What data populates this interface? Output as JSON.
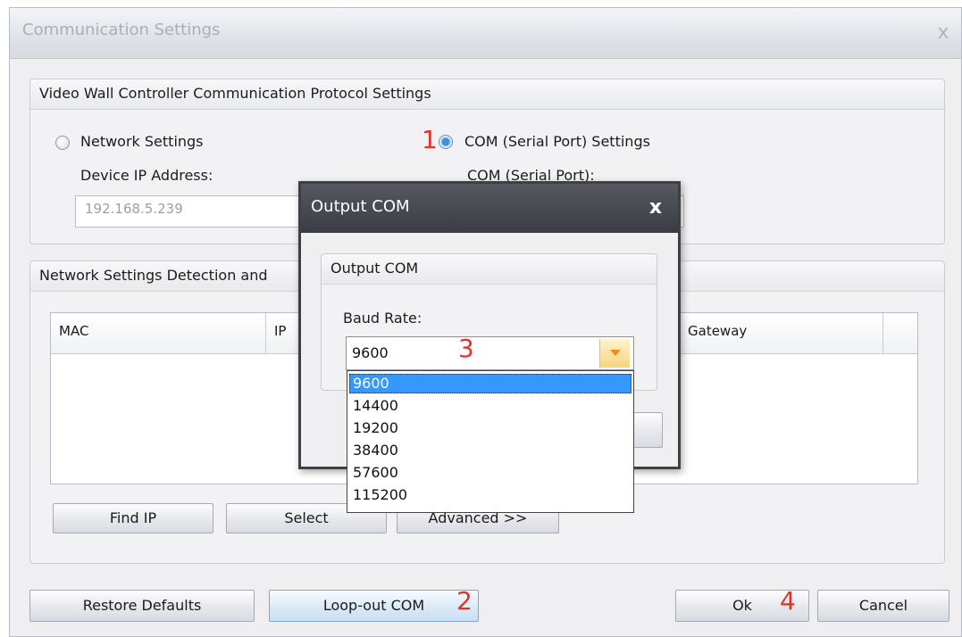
{
  "window": {
    "title": "Communication Settings",
    "close_glyph": "x"
  },
  "protocol_group": {
    "title": "Video Wall Controller Communication Protocol Settings",
    "network_radio_label": "Network Settings",
    "device_ip_label": "Device IP Address:",
    "device_ip_value": "192.168.5.239",
    "com_radio_label": "COM (Serial Port) Settings",
    "com_port_label": "COM (Serial Port):"
  },
  "detection_group": {
    "title": "Network Settings Detection and",
    "columns": [
      "MAC",
      "IP",
      "Gateway"
    ],
    "buttons": {
      "find_ip": "Find IP",
      "select": "Select",
      "advanced": "Advanced >>"
    }
  },
  "footer": {
    "restore_defaults": "Restore Defaults",
    "loop_out_com": "Loop-out COM",
    "ok": "Ok",
    "cancel": "Cancel"
  },
  "annotations": {
    "step1": "1",
    "step2": "2",
    "step3": "3",
    "step4": "4",
    "color": "#e0322a"
  },
  "dialog": {
    "title": "Output COM",
    "close_glyph": "x",
    "group_title": "Output COM",
    "baud_label": "Baud Rate:",
    "baud_value": "9600",
    "baud_options": [
      "9600",
      "14400",
      "19200",
      "38400",
      "57600",
      "115200"
    ],
    "selected_option": "9600"
  },
  "colors": {
    "highlight": "#3399ff",
    "dialog_bar": "#3d4047"
  }
}
